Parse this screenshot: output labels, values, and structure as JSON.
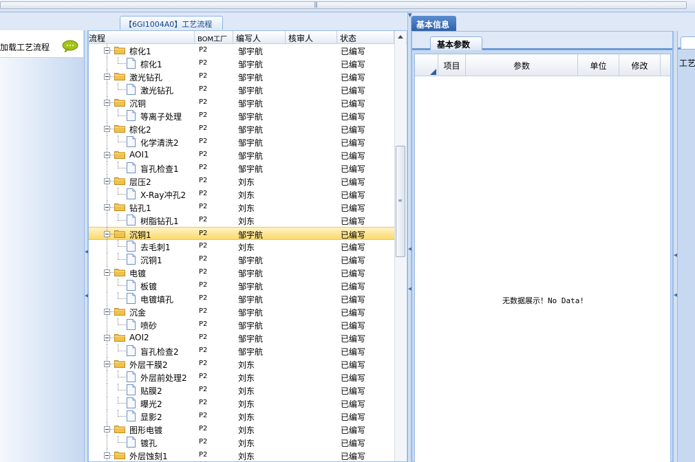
{
  "left_panel": {
    "item_label": "加载工艺流程",
    "item_icon": "chat-bubble-icon"
  },
  "tree_panel": {
    "tab_title": "【6GI1004A0】工艺流程",
    "columns": [
      "流程",
      "BOM工厂",
      "编写人",
      "核审人",
      "状态"
    ],
    "rows": [
      {
        "level": 0,
        "name": "棕化1",
        "bom": "P2",
        "author": "邹宇航",
        "reviewer": "",
        "status": "已编写"
      },
      {
        "level": 1,
        "name": "棕化1",
        "bom": "P2",
        "author": "邹宇航",
        "reviewer": "",
        "status": "已编写"
      },
      {
        "level": 0,
        "name": "激光钻孔",
        "bom": "P2",
        "author": "邹宇航",
        "reviewer": "",
        "status": "已编写"
      },
      {
        "level": 1,
        "name": "激光钻孔",
        "bom": "P2",
        "author": "邹宇航",
        "reviewer": "",
        "status": "已编写"
      },
      {
        "level": 0,
        "name": "沉铜",
        "bom": "P2",
        "author": "邹宇航",
        "reviewer": "",
        "status": "已编写"
      },
      {
        "level": 1,
        "name": "等离子处理",
        "bom": "P2",
        "author": "邹宇航",
        "reviewer": "",
        "status": "已编写"
      },
      {
        "level": 0,
        "name": "棕化2",
        "bom": "P2",
        "author": "邹宇航",
        "reviewer": "",
        "status": "已编写"
      },
      {
        "level": 1,
        "name": "化学清洗2",
        "bom": "P2",
        "author": "邹宇航",
        "reviewer": "",
        "status": "已编写"
      },
      {
        "level": 0,
        "name": "AOI1",
        "bom": "P2",
        "author": "邹宇航",
        "reviewer": "",
        "status": "已编写"
      },
      {
        "level": 1,
        "name": "盲孔检查1",
        "bom": "P2",
        "author": "邹宇航",
        "reviewer": "",
        "status": "已编写"
      },
      {
        "level": 0,
        "name": "层压2",
        "bom": "P2",
        "author": "刘东",
        "reviewer": "",
        "status": "已编写"
      },
      {
        "level": 1,
        "name": "X-Ray冲孔2",
        "bom": "P2",
        "author": "刘东",
        "reviewer": "",
        "status": "已编写"
      },
      {
        "level": 0,
        "name": "钻孔1",
        "bom": "P2",
        "author": "刘东",
        "reviewer": "",
        "status": "已编写"
      },
      {
        "level": 1,
        "name": "树脂钻孔1",
        "bom": "P2",
        "author": "刘东",
        "reviewer": "",
        "status": "已编写"
      },
      {
        "level": 0,
        "name": "沉铜1",
        "bom": "P2",
        "author": "邹宇航",
        "reviewer": "",
        "status": "已编写",
        "selected": true
      },
      {
        "level": 1,
        "name": "去毛刺1",
        "bom": "P2",
        "author": "刘东",
        "reviewer": "",
        "status": "已编写"
      },
      {
        "level": 1,
        "name": "沉铜1",
        "bom": "P2",
        "author": "邹宇航",
        "reviewer": "",
        "status": "已编写"
      },
      {
        "level": 0,
        "name": "电镀",
        "bom": "P2",
        "author": "邹宇航",
        "reviewer": "",
        "status": "已编写"
      },
      {
        "level": 1,
        "name": "板镀",
        "bom": "P2",
        "author": "邹宇航",
        "reviewer": "",
        "status": "已编写"
      },
      {
        "level": 1,
        "name": "电镀填孔",
        "bom": "P2",
        "author": "邹宇航",
        "reviewer": "",
        "status": "已编写"
      },
      {
        "level": 0,
        "name": "沉金",
        "bom": "P2",
        "author": "邹宇航",
        "reviewer": "",
        "status": "已编写"
      },
      {
        "level": 1,
        "name": "喷砂",
        "bom": "P2",
        "author": "邹宇航",
        "reviewer": "",
        "status": "已编写"
      },
      {
        "level": 0,
        "name": "AOI2",
        "bom": "P2",
        "author": "邹宇航",
        "reviewer": "",
        "status": "已编写"
      },
      {
        "level": 1,
        "name": "盲孔检查2",
        "bom": "P2",
        "author": "邹宇航",
        "reviewer": "",
        "status": "已编写"
      },
      {
        "level": 0,
        "name": "外层干膜2",
        "bom": "P2",
        "author": "刘东",
        "reviewer": "",
        "status": "已编写"
      },
      {
        "level": 1,
        "name": "外层前处理2",
        "bom": "P2",
        "author": "刘东",
        "reviewer": "",
        "status": "已编写"
      },
      {
        "level": 1,
        "name": "贴膜2",
        "bom": "P2",
        "author": "刘东",
        "reviewer": "",
        "status": "已编写"
      },
      {
        "level": 1,
        "name": "曝光2",
        "bom": "P2",
        "author": "刘东",
        "reviewer": "",
        "status": "已编写"
      },
      {
        "level": 1,
        "name": "显影2",
        "bom": "P2",
        "author": "刘东",
        "reviewer": "",
        "status": "已编写"
      },
      {
        "level": 0,
        "name": "图形电镀",
        "bom": "P2",
        "author": "刘东",
        "reviewer": "",
        "status": "已编写"
      },
      {
        "level": 1,
        "name": "镀孔",
        "bom": "P2",
        "author": "刘东",
        "reviewer": "",
        "status": "已编写"
      },
      {
        "level": 0,
        "name": "外层蚀刻1",
        "bom": "P2",
        "author": "刘东",
        "reviewer": "",
        "status": "已编写"
      }
    ]
  },
  "info_panel": {
    "tab_title": "基本信息",
    "subtab_title": "基本参数",
    "columns": [
      "项目",
      "参数",
      "单位",
      "修改"
    ],
    "empty_prefix": "无数据展示！",
    "empty_suffix": "No Data!"
  },
  "far_right_panel": {
    "label": "工艺"
  },
  "colors": {
    "accent": "#2b5fa7",
    "panel_border": "#99bbe8",
    "selected_row": "#fbd96a",
    "folder": "#f0c14b"
  }
}
